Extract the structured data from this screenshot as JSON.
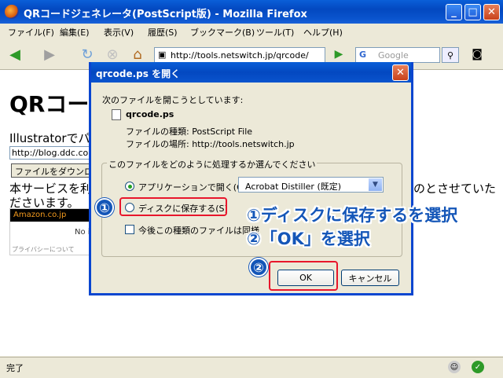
{
  "window": {
    "title": "QRコードジェネレータ(PostScript版) - Mozilla Firefox",
    "min_glyph": "_",
    "max_glyph": "□",
    "close_glyph": "✕"
  },
  "menubar": {
    "items": [
      "ファイル(F)",
      "編集(E)",
      "表示(V)",
      "履歴(S)",
      "ブックマーク(B)",
      "ツール(T)",
      "ヘルプ(H)"
    ]
  },
  "navbar": {
    "url": "http://tools.netswitch.jp/qrcode/",
    "search_engine": "G",
    "search_placeholder": "Google"
  },
  "page": {
    "heading": "QRコー",
    "illustrator_text": "Illustratorでパ",
    "input_value": "http://blog.ddc.co",
    "download_button": "ファイルをダウンロー",
    "service_line1": "本サービスを利",
    "service_line2": "ださいます。",
    "service_right": "のとさせてい",
    "service_right_tail": "た",
    "amazon_label": "Amazon.co.jp",
    "amazon_noimg": "No i",
    "amazon_privacy": "プライバシーについて"
  },
  "status": {
    "text": "完了"
  },
  "dialog": {
    "title": "qrcode.ps を開く",
    "close_glyph": "✕",
    "intro": "次のファイルを開こうとしています:",
    "filename": "qrcode.ps",
    "filetype": "ファイルの種類: PostScript File",
    "filelocation": "ファイルの場所: http://tools.netswitch.jp",
    "question": "このファイルをどのように処理するか選んでください",
    "option_open": "アプリケーションで開く(O):",
    "app_selected": "Acrobat Distiller (既定)",
    "option_save": "ディスクに保存する(S)",
    "checkbox_label": "今後この種類のファイルは同様",
    "ok": "OK",
    "cancel": "キャンセル"
  },
  "annotations": {
    "num1": "①",
    "num2": "②",
    "callout1": "①ディスクに保存するを選択",
    "callout2": "②「OK」を選択",
    "accent_color": "#1456B8",
    "highlight_color": "#E8162C"
  },
  "colors": {
    "titlebar": "#0348C0",
    "chrome": "#ECE9D8"
  }
}
